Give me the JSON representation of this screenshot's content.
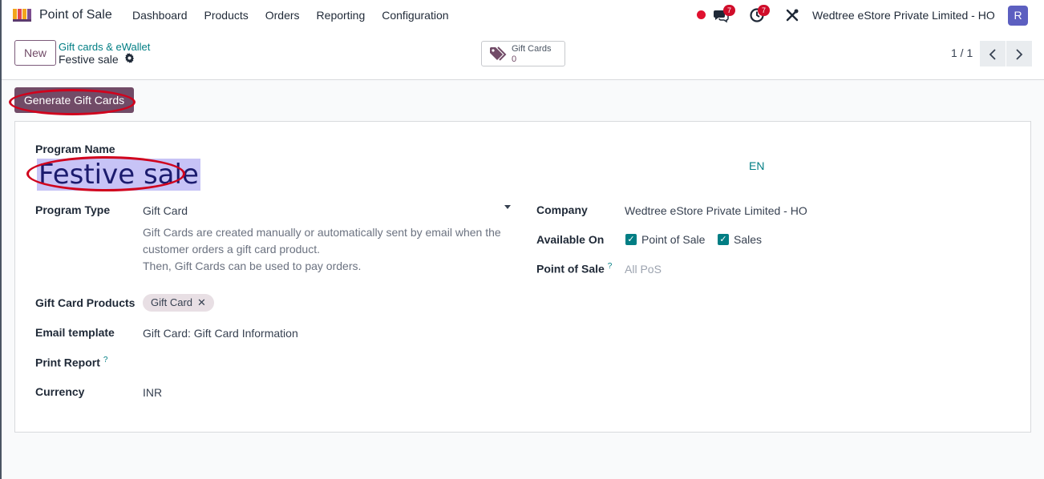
{
  "navbar": {
    "app_name": "Point of Sale",
    "menu": [
      "Dashboard",
      "Products",
      "Orders",
      "Reporting",
      "Configuration"
    ],
    "messages_count": "7",
    "activities_count": "7",
    "company": "Wedtree eStore Private Limited - HO",
    "avatar_initial": "R"
  },
  "control_panel": {
    "new_label": "New",
    "breadcrumb_parent": "Gift cards & eWallet",
    "breadcrumb_current": "Festive sale",
    "smart_button_label": "Gift Cards",
    "smart_button_value": "0",
    "pager": "1 / 1"
  },
  "actions": {
    "generate_label": "Generate Gift Cards"
  },
  "form": {
    "program_name_label": "Program Name",
    "program_name": "Festive sale",
    "lang": "EN",
    "program_type_label": "Program Type",
    "program_type": "Gift Card",
    "program_type_desc_1": "Gift Cards are created manually or automatically sent by email when the customer orders a gift card product.",
    "program_type_desc_2": "Then, Gift Cards can be used to pay orders.",
    "gift_card_products_label": "Gift Card Products",
    "gift_card_product_tag": "Gift Card",
    "email_template_label": "Email template",
    "email_template": "Gift Card: Gift Card Information",
    "print_report_label": "Print Report",
    "currency_label": "Currency",
    "currency": "INR",
    "company_label": "Company",
    "company": "Wedtree eStore Private Limited - HO",
    "available_on_label": "Available On",
    "available_on_pos": "Point of Sale",
    "available_on_sales": "Sales",
    "pos_label": "Point of Sale",
    "pos_placeholder": "All PoS",
    "help_mark": "?"
  },
  "colors": {
    "brand": "#714B67",
    "accent": "#017e84",
    "annotation": "#d0031d"
  }
}
